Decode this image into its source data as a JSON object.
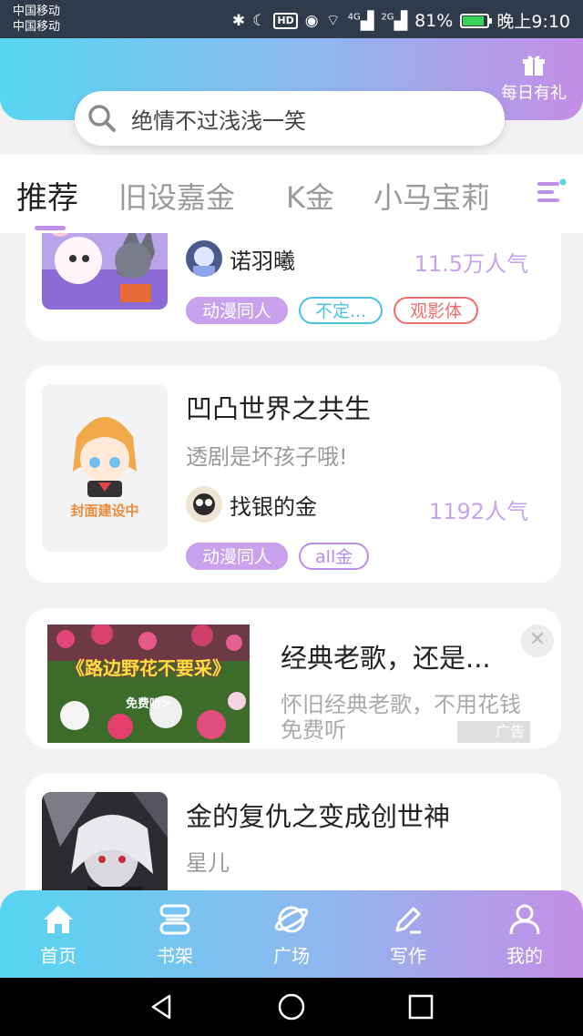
{
  "status_bar": {
    "carrier_1": "中国移动",
    "carrier_2": "中国移动",
    "hd": "HD",
    "net_1": "4G",
    "net_2": "2G",
    "battery": "81%",
    "time": "晚上9:10",
    "battery_level": 0.81
  },
  "header": {
    "daily_gift_label": "每日有礼"
  },
  "search": {
    "text": "绝情不过浅浅一笑"
  },
  "tabs": [
    {
      "label": "推荐",
      "active": true
    },
    {
      "label": "旧设嘉金"
    },
    {
      "label": "K金"
    },
    {
      "label": "小马宝莉"
    }
  ],
  "cards": [
    {
      "author": "诺羽曦",
      "popularity": "11.5万人气",
      "tags": [
        "动漫同人",
        "不定...",
        "观影体"
      ]
    },
    {
      "title": "凹凸世界之共生",
      "desc": "透剧是坏孩子哦!",
      "author": "找银的金",
      "popularity": "1192人气",
      "tags": [
        "动漫同人",
        "all金"
      ],
      "cover_text": "封面建设中"
    },
    {
      "title": "金的复仇之变成创世神",
      "desc": "星儿"
    }
  ],
  "ad": {
    "title": "经典老歌，还是...",
    "desc": "怀旧经典老歌，不用花钱免费听",
    "banner_title": "《路边野花不要采》",
    "banner_sub": "免费听>",
    "label": "广告",
    "close": "✕"
  },
  "bottom_nav": [
    {
      "label": "首页",
      "icon": "home-icon"
    },
    {
      "label": "书架",
      "icon": "bookshelf-icon"
    },
    {
      "label": "广场",
      "icon": "planet-icon"
    },
    {
      "label": "写作",
      "icon": "pen-icon"
    },
    {
      "label": "我的",
      "icon": "user-icon"
    }
  ],
  "colors": {
    "accent_purple": "#c9a1ec",
    "accent_cyan": "#57d6f1"
  }
}
